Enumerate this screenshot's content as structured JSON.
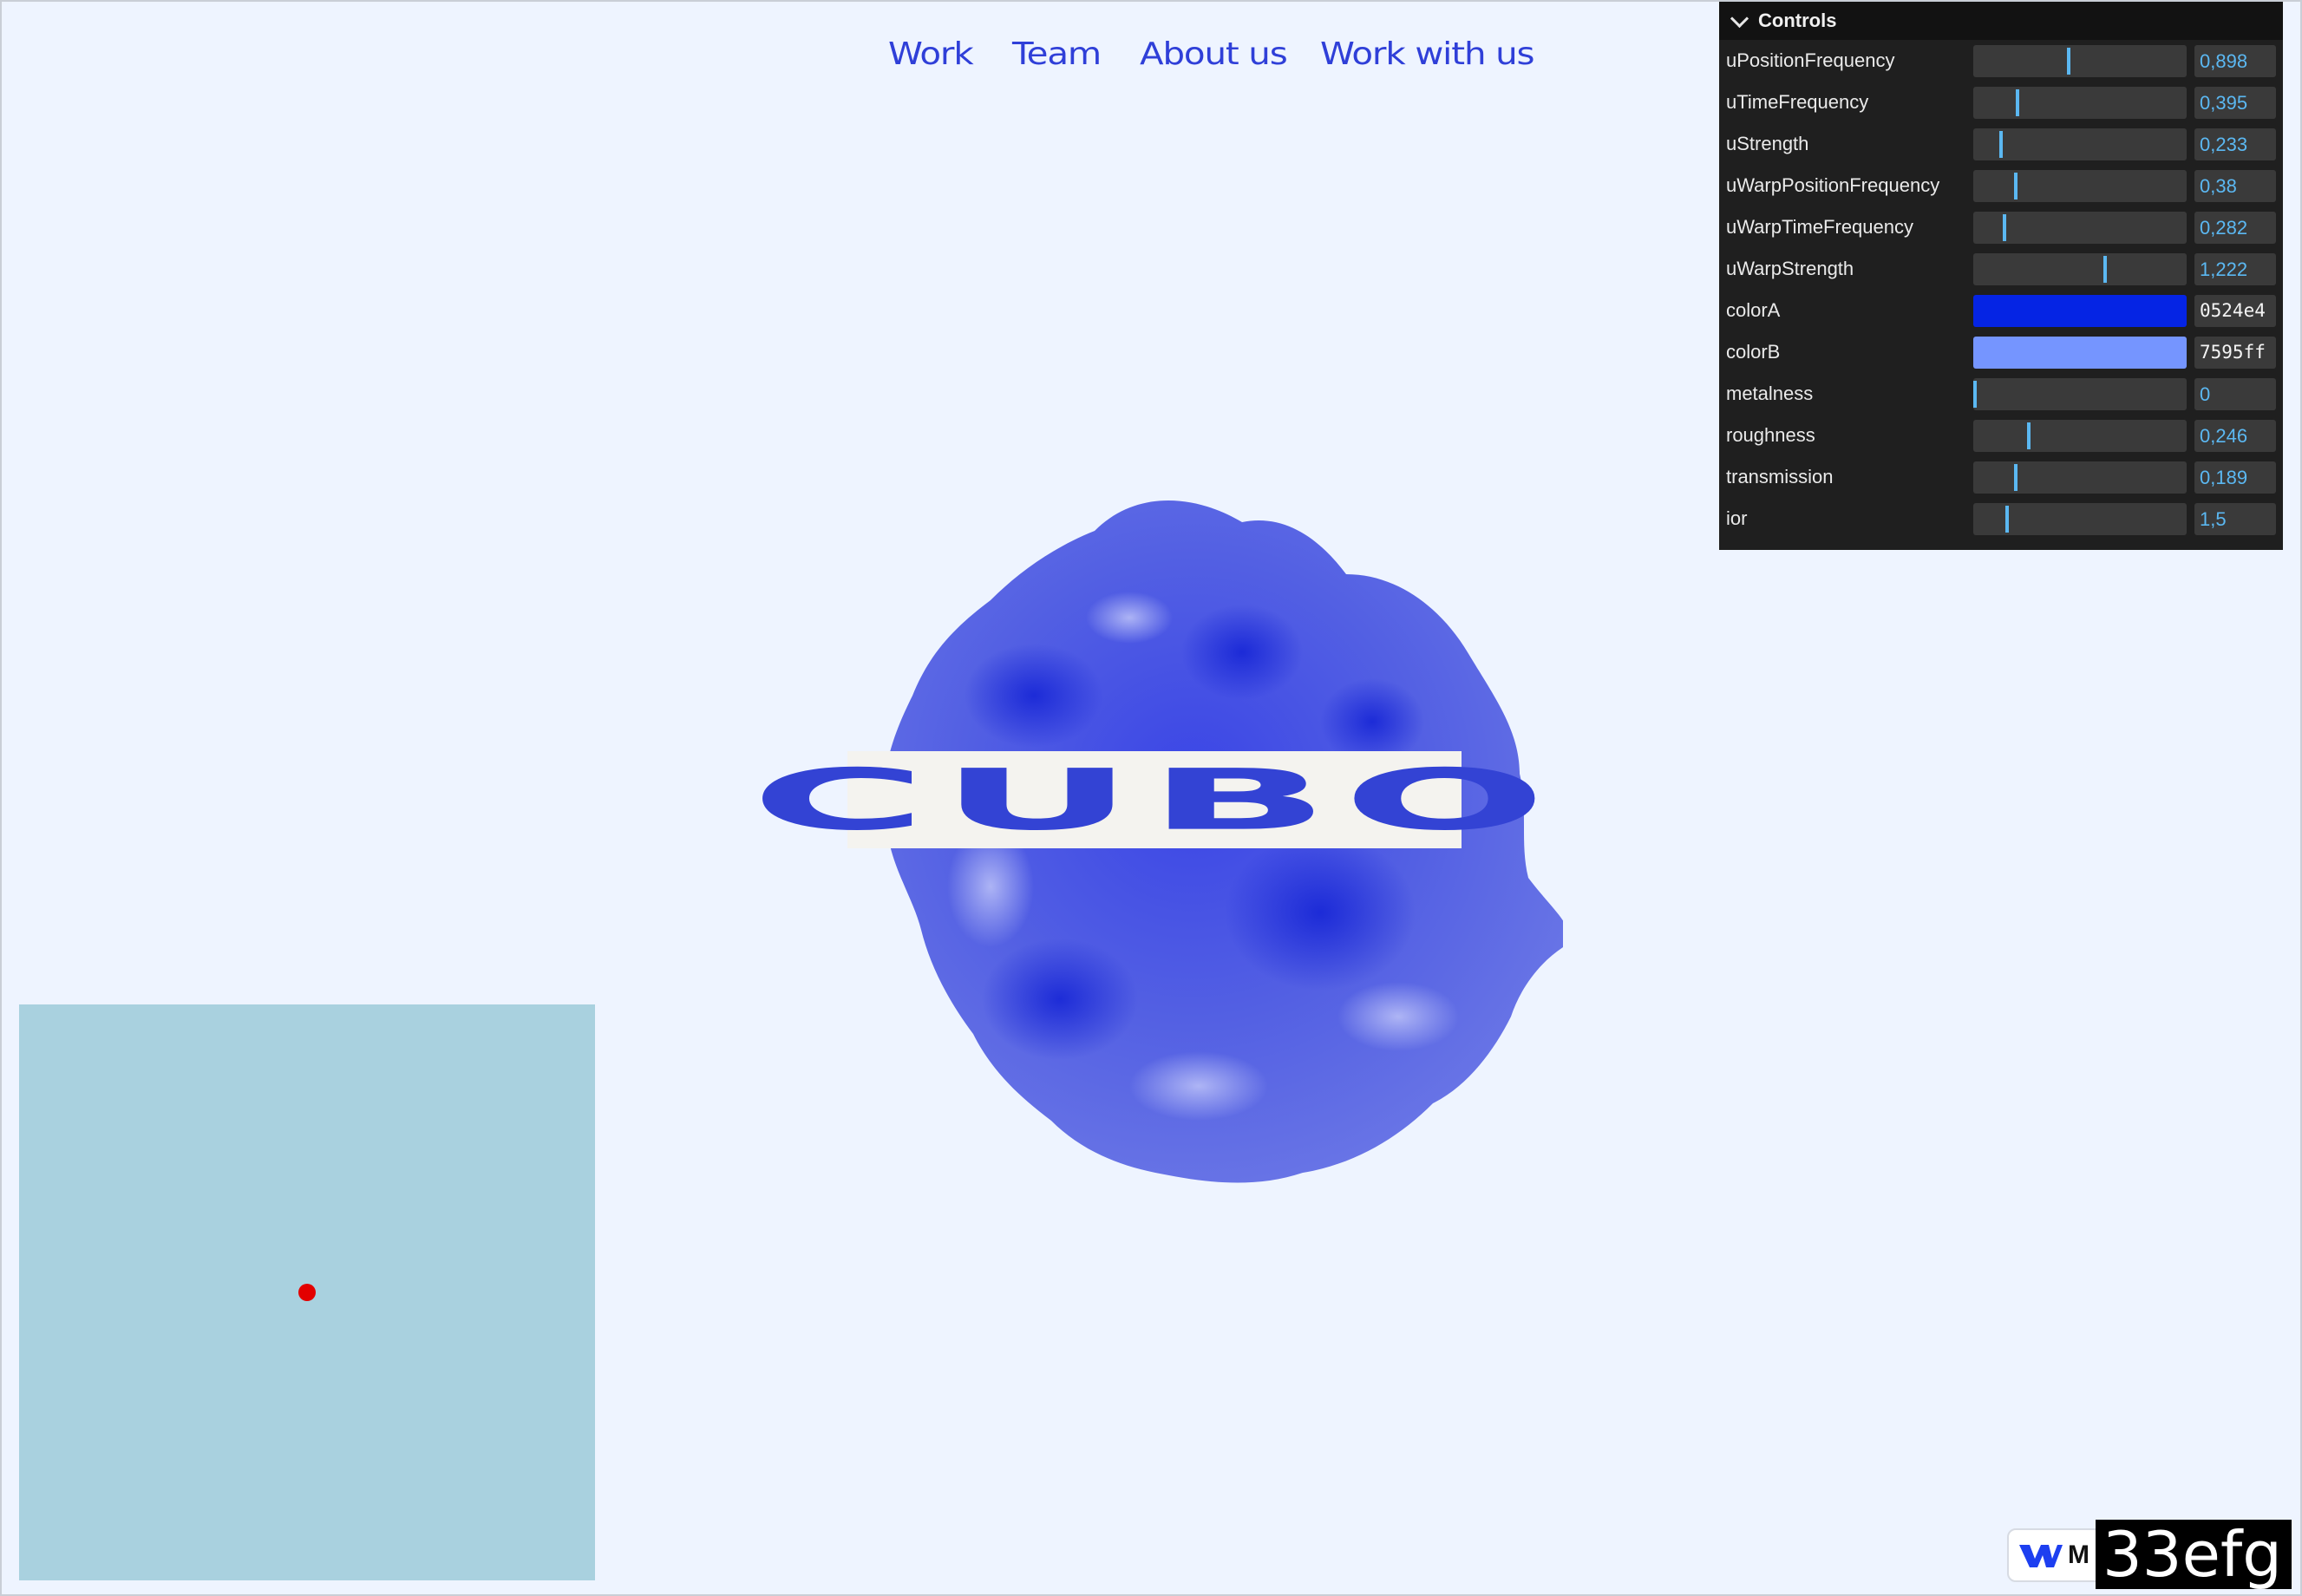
{
  "nav": {
    "items": [
      {
        "label": "Work"
      },
      {
        "label": "Team"
      },
      {
        "label": "About us"
      },
      {
        "label": "Work with us"
      }
    ]
  },
  "hero": {
    "logo_text": "CUBO"
  },
  "controls": {
    "title": "Controls",
    "rows": [
      {
        "label": "uPositionFrequency",
        "value": "0,898",
        "level": 0.44
      },
      {
        "label": "uTimeFrequency",
        "value": "0,395",
        "level": 0.2
      },
      {
        "label": "uStrength",
        "value": "0,233",
        "level": 0.12
      },
      {
        "label": "uWarpPositionFrequency",
        "value": "0,38",
        "level": 0.19
      },
      {
        "label": "uWarpTimeFrequency",
        "value": "0,282",
        "level": 0.14
      },
      {
        "label": "uWarpStrength",
        "value": "1,222",
        "level": 0.61
      },
      {
        "label": "colorA",
        "value": "0524e4",
        "color": "#0524e4"
      },
      {
        "label": "colorB",
        "value": "7595ff",
        "color": "#7595ff"
      },
      {
        "label": "metalness",
        "value": "0",
        "level": 0.0
      },
      {
        "label": "roughness",
        "value": "0,246",
        "level": 0.25
      },
      {
        "label": "transmission",
        "value": "0,189",
        "level": 0.19
      },
      {
        "label": "ior",
        "value": "1,5",
        "level": 0.15
      }
    ]
  },
  "debug": {
    "dot_position": [
      0.5,
      0.5
    ],
    "dot_color": "#e30000",
    "background": "#a9d1df"
  },
  "badge": {
    "icon": "webflow-logo-icon",
    "text": "M"
  },
  "stats": {
    "text": "33efg"
  },
  "colors": {
    "page_background": "#eef4ff",
    "nav_link": "#2f3fd8",
    "panel_background": "#1f1f1f",
    "slider_accent": "#5bb8f2",
    "blob": "#4a55e0"
  }
}
